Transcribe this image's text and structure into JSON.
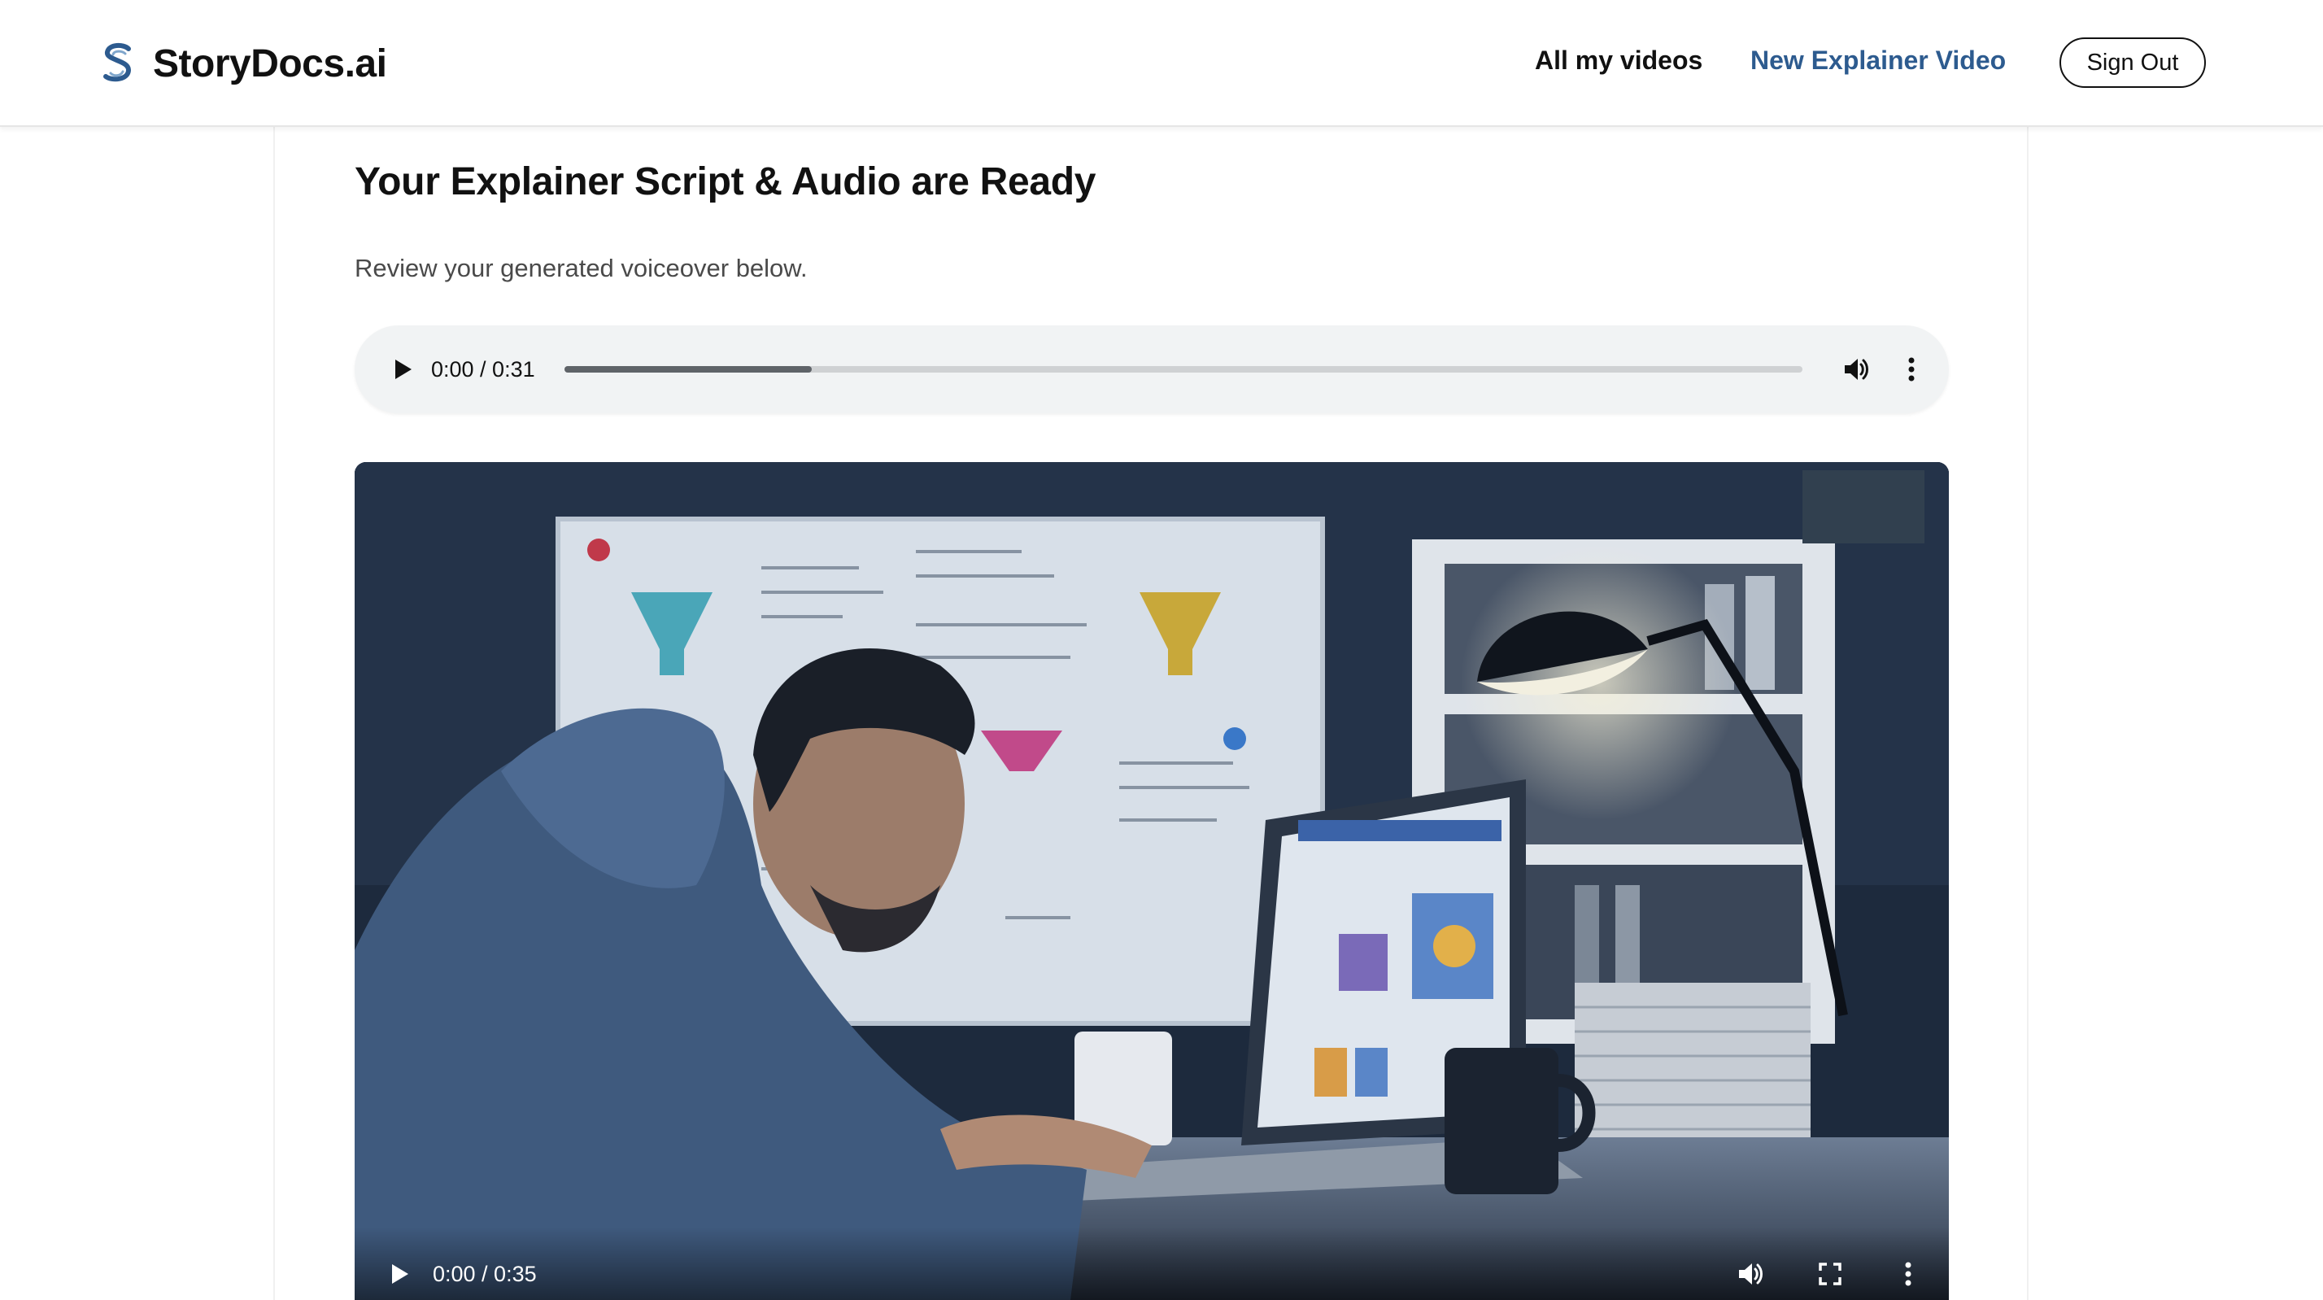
{
  "header": {
    "brand_name": "StoryDocs.ai",
    "nav": {
      "all_videos": "All my videos",
      "new_video": "New Explainer Video",
      "sign_out": "Sign Out"
    }
  },
  "main": {
    "title": "Your Explainer Script & Audio are Ready",
    "subtitle": "Review your generated voiceover below."
  },
  "audio_player": {
    "time_display": "0:00 / 0:31",
    "buffered_fraction": 0.2
  },
  "video_player": {
    "time_display": "0:00 / 0:35"
  },
  "colors": {
    "brand_accent": "#2d5b8f",
    "player_bg": "#f1f3f4",
    "text": "#111111"
  },
  "icons": {
    "brand": "storydocs-logo-icon",
    "play": "play-icon",
    "volume": "volume-icon",
    "more": "more-vertical-icon",
    "fullscreen": "fullscreen-icon"
  }
}
